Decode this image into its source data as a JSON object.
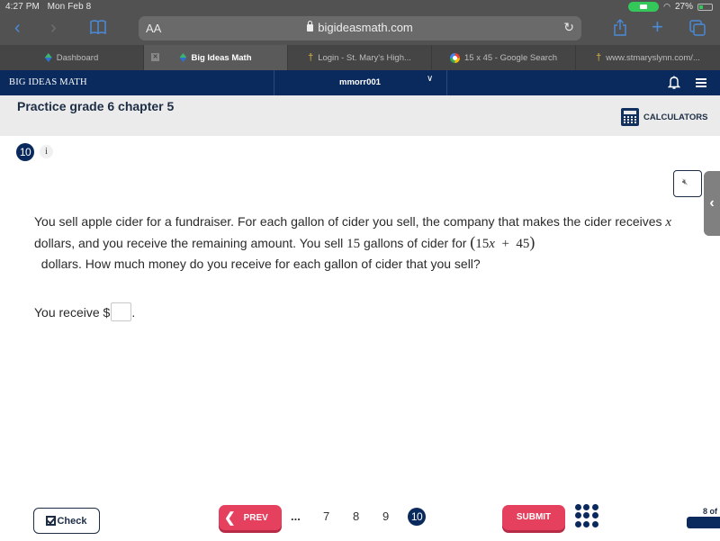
{
  "status_bar": {
    "time": "4:27 PM",
    "date": "Mon Feb 8",
    "battery": "27%"
  },
  "safari": {
    "text_size_label": "AA",
    "url": "bigideasmath.com"
  },
  "tabs": [
    {
      "label": "Dashboard",
      "favicon": "big-ideas-favicon",
      "active": false
    },
    {
      "label": "Big Ideas Math",
      "favicon": "big-ideas-favicon",
      "active": true
    },
    {
      "label": "Login - St. Mary's High...",
      "favicon": "st-marys-favicon",
      "active": false
    },
    {
      "label": "15 x 45 - Google Search",
      "favicon": "google-favicon",
      "active": false
    },
    {
      "label": "www.stmaryslynn.com/...",
      "favicon": "st-marys-favicon",
      "active": false
    }
  ],
  "app_header": {
    "logo": "BIG IDEAS MATH",
    "username": "mmorr001"
  },
  "assignment": {
    "title": "Practice grade 6 chapter 5",
    "calculators_label": "CALCULATORS"
  },
  "question": {
    "number": "10",
    "info_label": "i",
    "text_parts": {
      "p1": "You sell apple cider for a fundraiser. For each gallon of cider you sell, the company that makes the cider receives ",
      "var": "x",
      "p2": " dollars, and you receive the remaining amount. You sell ",
      "num": "15",
      "p3": " gallons of cider for ",
      "expr_open": "(",
      "expr": "15x + 45",
      "expr_close": ")",
      "p4": " dollars. How much money do you receive for each gallon of cider that you sell?"
    },
    "answer_prefix": "You receive $",
    "answer_value": "",
    "answer_suffix": "."
  },
  "footer": {
    "check_label": "Check",
    "prev_label": "PREV",
    "pages": [
      "...",
      "7",
      "8",
      "9"
    ],
    "current_page": "10",
    "submit_label": "SUBMIT",
    "progress_label": "8 of",
    "progress_fraction": 0.8
  }
}
